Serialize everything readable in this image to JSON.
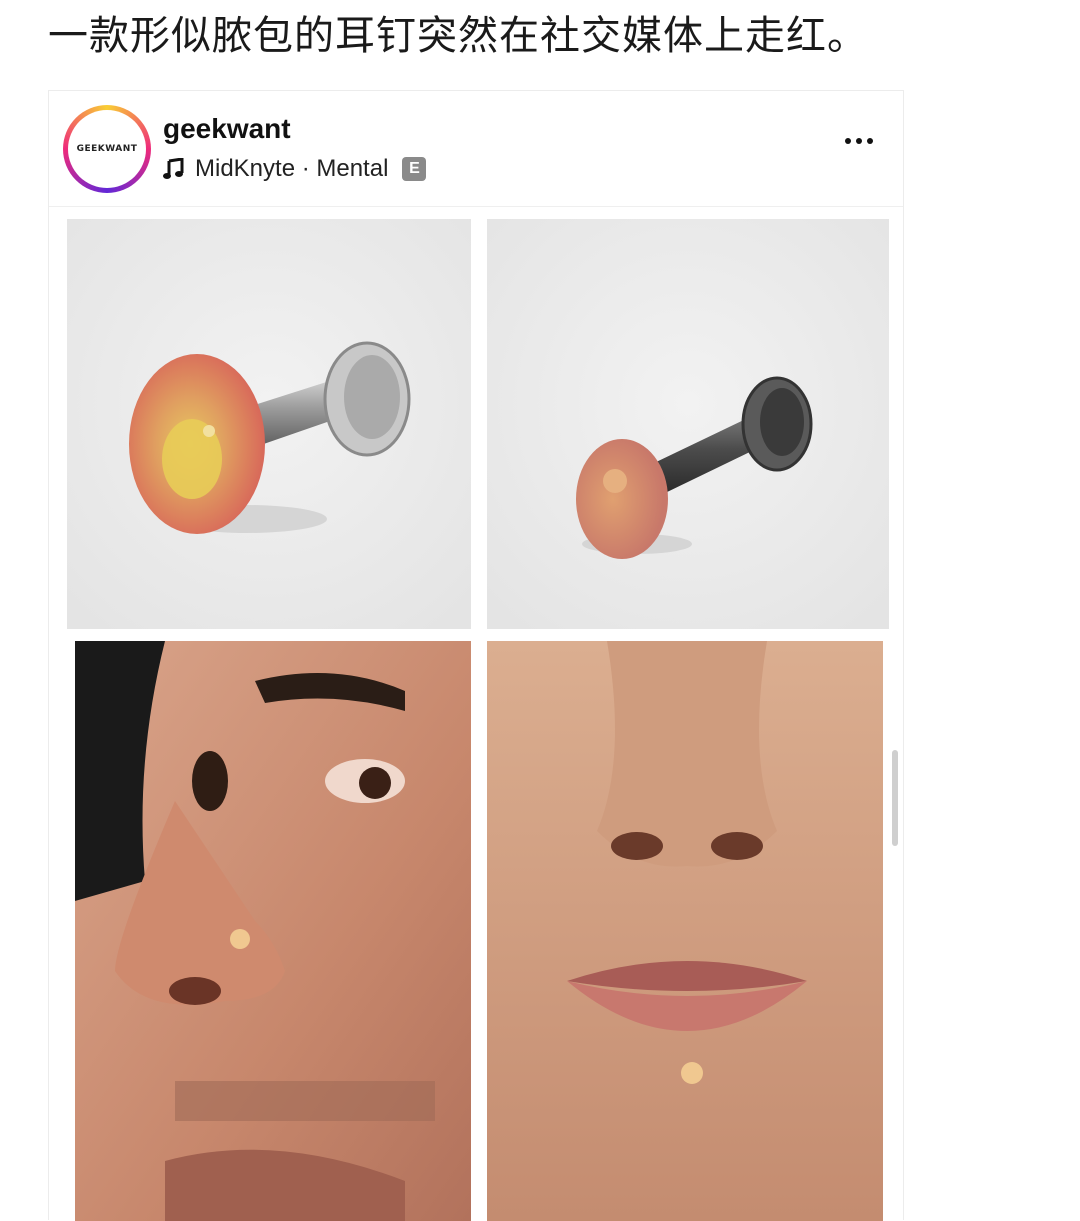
{
  "headline": "一款形似脓包的耳钉突然在社交媒体上走红。",
  "post": {
    "avatar_text": "GEEKWANT",
    "username": "geekwant",
    "music_icon": "music-note-icon",
    "music_text": "MidKnyte · Mental",
    "explicit_badge": "E",
    "more_icon": "more-horizontal-icon"
  },
  "colors": {
    "avatar_ring": [
      "#f9ce34",
      "#ee2a7b",
      "#6228d7"
    ],
    "photo_bg": "#ebebeb"
  }
}
